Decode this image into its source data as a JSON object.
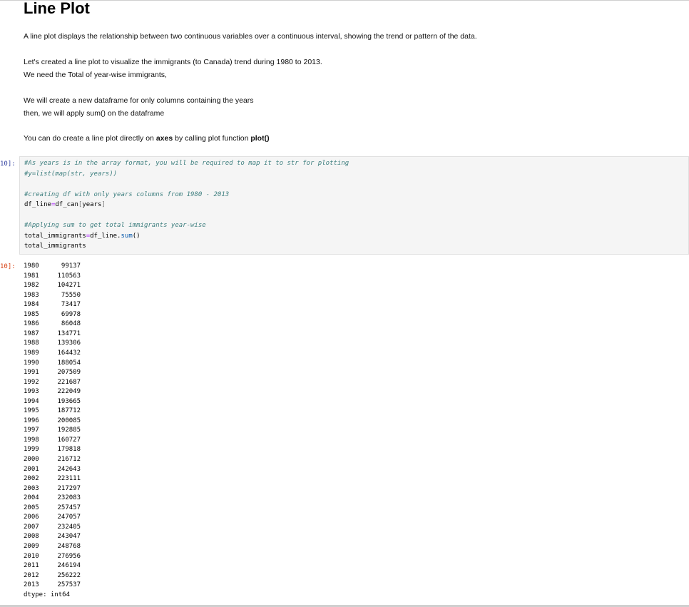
{
  "markdown": {
    "title": "Line Plot",
    "p1": "A line plot displays the relationship between two continuous variables over a continuous interval, showing the trend or pattern of the data.",
    "p2": "Let's created a line plot to visualize the immigrants (to Canada) trend during 1980 to 2013.",
    "p3": "We need the Total of year-wise immigrants,",
    "p4": "We will create a new dataframe for only columns containing the years",
    "p5": "then, we will apply sum() on the dataframe",
    "p6_pre": "You can do create a line plot directly on ",
    "p6_bold1": "axes",
    "p6_mid": " by calling plot function ",
    "p6_bold2": "plot()"
  },
  "code_cell": {
    "prompt": "10]:",
    "lines": {
      "l1": "#As years is in the array format, you will be required to map it to str for plotting",
      "l2": "#y=list(map(str, years))",
      "l3": "#creating df with only years columns from 1980 - 2013",
      "l4_a": "df_line",
      "l4_op": "=",
      "l4_b": "df_can",
      "l4_c": "[",
      "l4_d": "years",
      "l4_e": "]",
      "l5": "#Applying sum to get total immigrants year-wise",
      "l6_a": "total_immigrants",
      "l6_op": "=",
      "l6_b": "df_line.",
      "l6_fn": "sum",
      "l6_c": "()",
      "l7": "total_immigrants"
    }
  },
  "output_cell": {
    "prompt": "10]:",
    "rows": [
      {
        "year": "1980",
        "value": "99137"
      },
      {
        "year": "1981",
        "value": "110563"
      },
      {
        "year": "1982",
        "value": "104271"
      },
      {
        "year": "1983",
        "value": "75550"
      },
      {
        "year": "1984",
        "value": "73417"
      },
      {
        "year": "1985",
        "value": "69978"
      },
      {
        "year": "1986",
        "value": "86048"
      },
      {
        "year": "1987",
        "value": "134771"
      },
      {
        "year": "1988",
        "value": "139306"
      },
      {
        "year": "1989",
        "value": "164432"
      },
      {
        "year": "1990",
        "value": "188054"
      },
      {
        "year": "1991",
        "value": "207509"
      },
      {
        "year": "1992",
        "value": "221687"
      },
      {
        "year": "1993",
        "value": "222049"
      },
      {
        "year": "1994",
        "value": "193665"
      },
      {
        "year": "1995",
        "value": "187712"
      },
      {
        "year": "1996",
        "value": "200085"
      },
      {
        "year": "1997",
        "value": "192885"
      },
      {
        "year": "1998",
        "value": "160727"
      },
      {
        "year": "1999",
        "value": "179818"
      },
      {
        "year": "2000",
        "value": "216712"
      },
      {
        "year": "2001",
        "value": "242643"
      },
      {
        "year": "2002",
        "value": "223111"
      },
      {
        "year": "2003",
        "value": "217297"
      },
      {
        "year": "2004",
        "value": "232083"
      },
      {
        "year": "2005",
        "value": "257457"
      },
      {
        "year": "2006",
        "value": "247057"
      },
      {
        "year": "2007",
        "value": "232405"
      },
      {
        "year": "2008",
        "value": "243047"
      },
      {
        "year": "2009",
        "value": "248768"
      },
      {
        "year": "2010",
        "value": "276956"
      },
      {
        "year": "2011",
        "value": "246194"
      },
      {
        "year": "2012",
        "value": "256222"
      },
      {
        "year": "2013",
        "value": "257537"
      }
    ],
    "dtype": "dtype: int64"
  },
  "colors": {
    "input_prompt": "#303f9f",
    "output_prompt": "#d84315",
    "comment": "#408080",
    "code_bg": "#f5f5f5"
  }
}
